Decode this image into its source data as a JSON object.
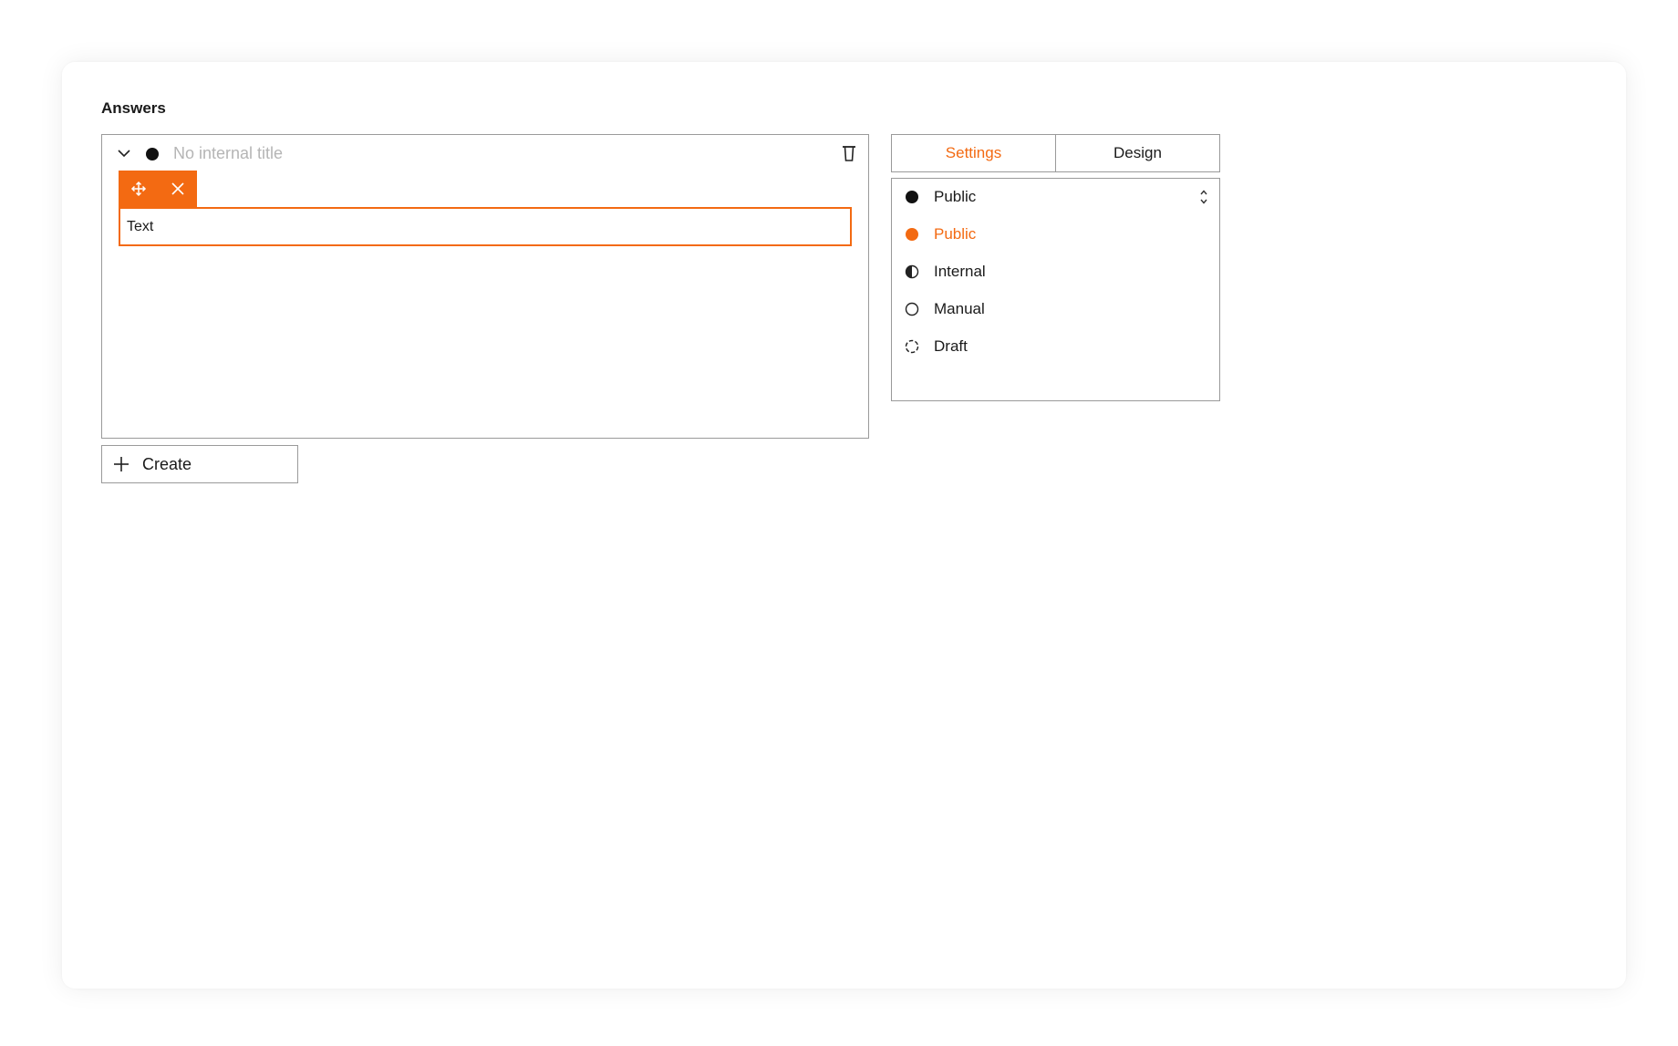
{
  "section": {
    "title": "Answers"
  },
  "answer": {
    "placeholder_title": "No internal title",
    "status_color": "#111111",
    "text_block": "Text"
  },
  "create_button": {
    "label": "Create"
  },
  "tabs": [
    {
      "label": "Settings",
      "active": true
    },
    {
      "label": "Design",
      "active": false
    }
  ],
  "status_select": {
    "current": {
      "label": "Public",
      "icon": "filled-circle-icon"
    },
    "options": [
      {
        "label": "Public",
        "icon": "filled-circle-icon",
        "color": "#f36a12"
      },
      {
        "label": "Internal",
        "icon": "half-circle-icon"
      },
      {
        "label": "Manual",
        "icon": "empty-circle-icon"
      },
      {
        "label": "Draft",
        "icon": "dashed-circle-icon"
      }
    ]
  },
  "colors": {
    "accent": "#f36a12",
    "border": "#9a9a9a",
    "muted_text": "#b5b5b5"
  }
}
